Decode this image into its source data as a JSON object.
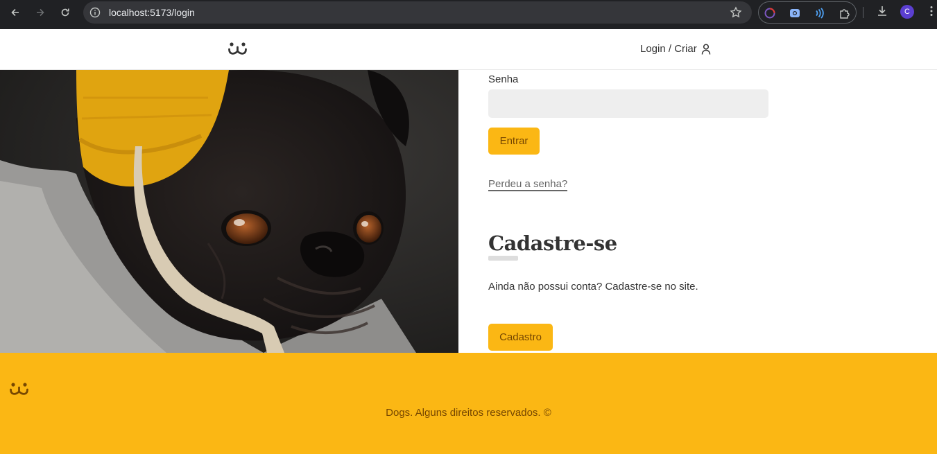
{
  "browser": {
    "url": "localhost:5173/login",
    "profile_initial": "C",
    "icons": [
      "back-arrow-icon",
      "forward-arrow-icon",
      "reload-icon",
      "site-info-icon",
      "bookmark-star-icon",
      "extension-icons",
      "downloads-icon",
      "menu-dots-icon"
    ]
  },
  "header": {
    "nav_link": "Login / Criar",
    "logo_icon": "dog-logo-icon",
    "user_icon": "user-icon"
  },
  "login": {
    "password_label": "Senha",
    "password_value": "",
    "submit_label": "Entrar",
    "lost_password": "Perdeu a senha?"
  },
  "register": {
    "title": "Cadastre-se",
    "text": "Ainda não possui conta? Cadastre-se no site.",
    "button_label": "Cadastro"
  },
  "footer": {
    "text": "Dogs. Alguns direitos reservados. ©"
  },
  "colors": {
    "accent": "#fbb714",
    "accent_text": "#764701",
    "chrome_bg": "#202124"
  }
}
